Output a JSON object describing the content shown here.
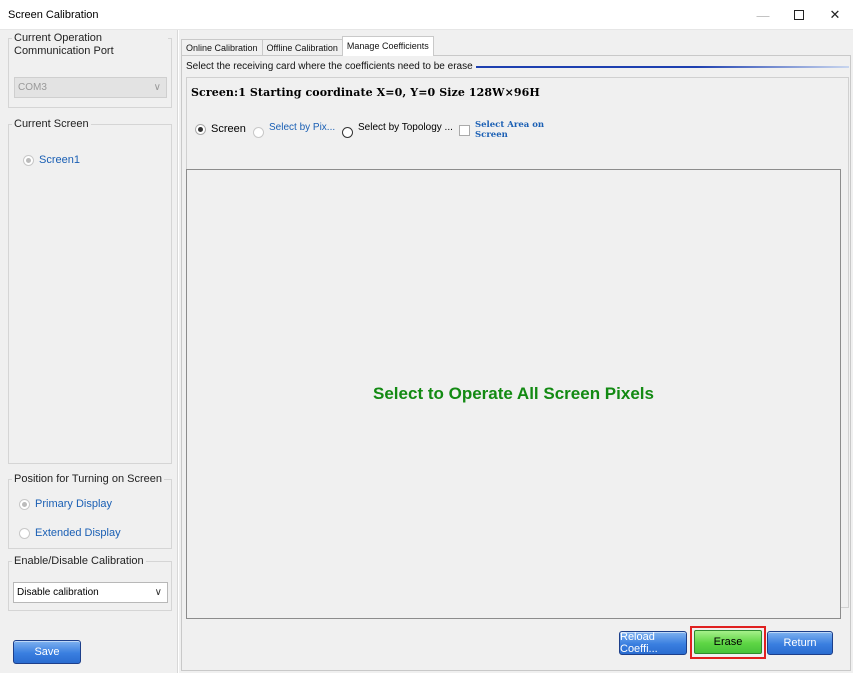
{
  "window": {
    "title": "Screen Calibration",
    "controls": {
      "minimize": "—",
      "maximize": "",
      "close": "✕"
    }
  },
  "left": {
    "comm_group_title": "Current Operation Communication Port",
    "comm_port_value": "COM3",
    "current_screen_title": "Current Screen",
    "screens": [
      {
        "label": "Screen1",
        "checked": true
      }
    ],
    "position_group_title": "Position for Turning on Screen",
    "position_options": [
      {
        "label": "Primary Display",
        "checked": true
      },
      {
        "label": "Extended Display",
        "checked": false
      }
    ],
    "calibration_group_title": "Enable/Disable Calibration",
    "calibration_value": "Disable calibration",
    "save_label": "Save"
  },
  "tabs": [
    {
      "label": "Online Calibration",
      "active": false
    },
    {
      "label": "Offline Calibration",
      "active": false
    },
    {
      "label": "Manage Coefficients",
      "active": true
    }
  ],
  "manage": {
    "hint": "Select the receiving card where the coefficients need to be erase",
    "screen_info": "Screen:1  Starting coordinate X=0, Y=0   Size 128W×96H",
    "options": {
      "screen": "Screen",
      "by_pixel": "Select by Pix...",
      "by_topology": "Select by Topology ...",
      "select_area_line1": "Select Area on",
      "select_area_line2": "Screen"
    },
    "canvas_message": "Select to Operate All Screen Pixels",
    "buttons": {
      "reload": "Reload Coeffi...",
      "erase": "Erase",
      "return": "Return"
    }
  },
  "icons": {
    "minimize": "minimize-icon",
    "maximize": "maximize-icon",
    "close": "close-icon",
    "dropdown": "chevron-down-icon"
  },
  "colors": {
    "accent_blue": "#3a7fe0",
    "erase_green": "#5ed645",
    "highlight_red": "#e02020",
    "message_green": "#138a13"
  }
}
